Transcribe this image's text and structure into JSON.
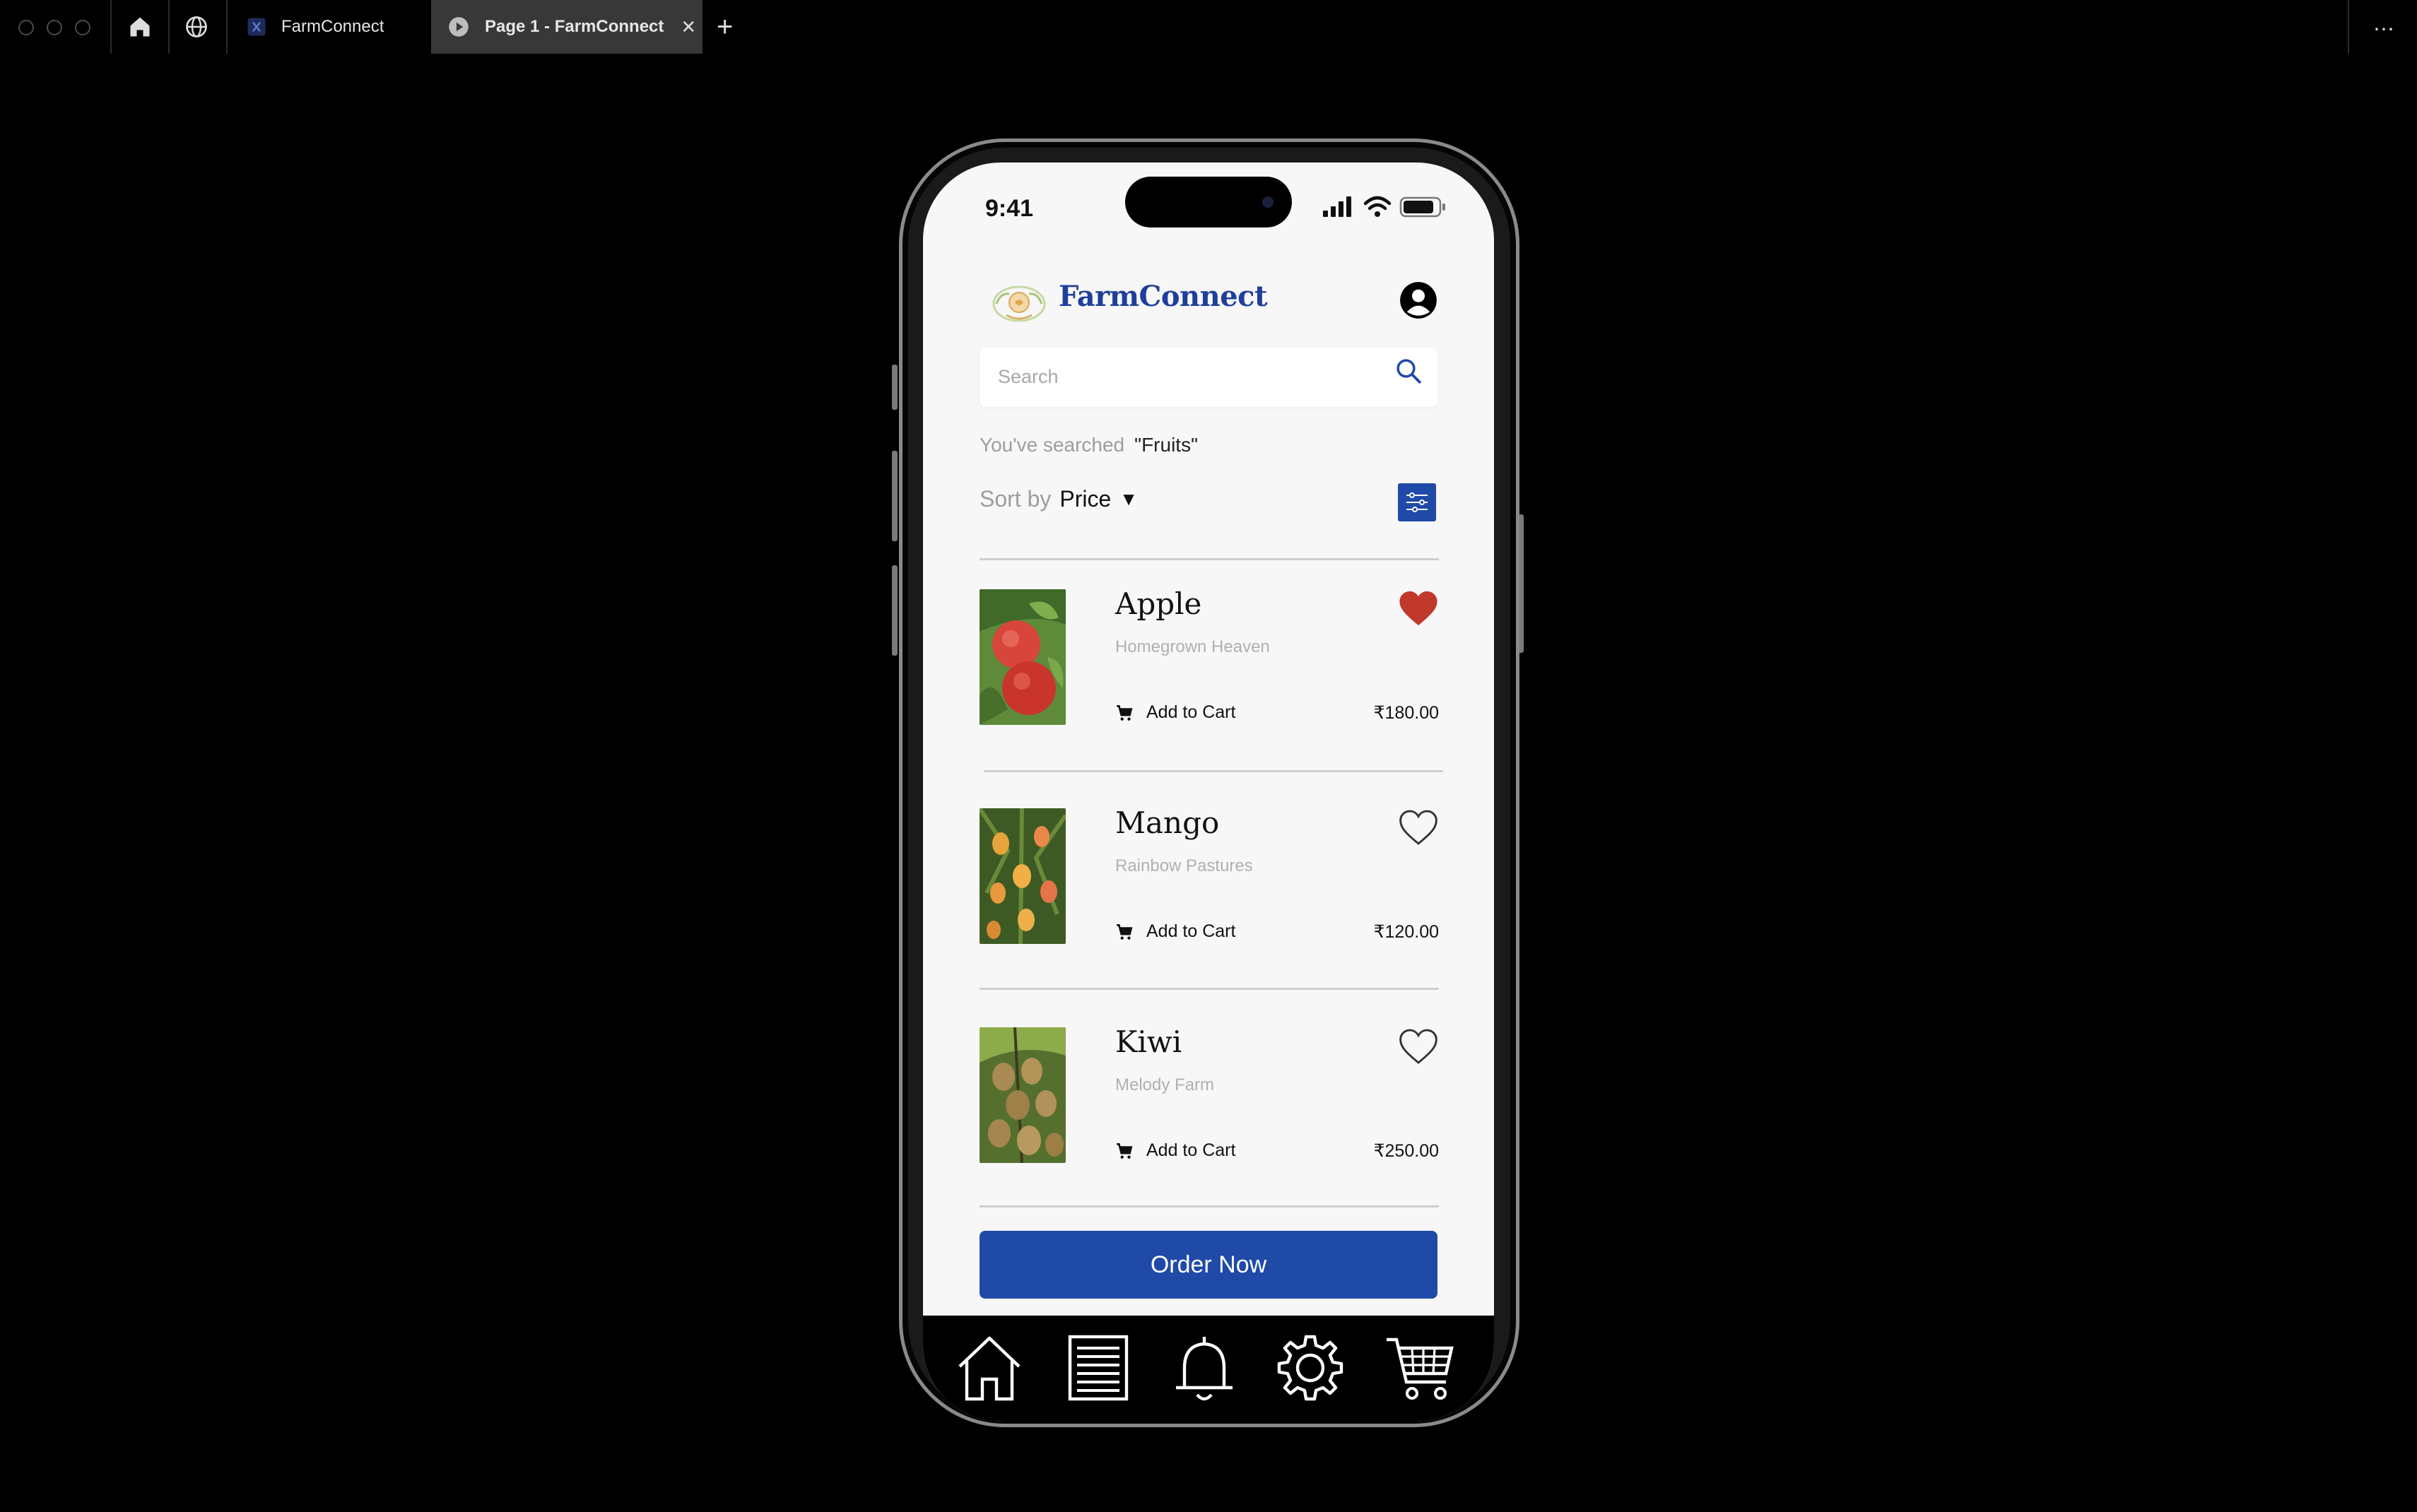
{
  "browser": {
    "tabs": [
      {
        "label": "FarmConnect",
        "icon": "figma-file-icon"
      },
      {
        "label": "Page 1 - FarmConnect",
        "icon": "play-icon",
        "close": "✕"
      }
    ],
    "new_tab": "+",
    "more": "⋯"
  },
  "status_bar": {
    "time": "9:41"
  },
  "app": {
    "brand": "FarmConnect",
    "search": {
      "placeholder": "Search",
      "value": ""
    },
    "searched_prefix": "You've searched",
    "searched_term": "\"Fruits\"",
    "sort_prefix": "Sort by",
    "sort_value": "Price",
    "sort_caret": "▼",
    "products": [
      {
        "name": "Apple",
        "farm": "Homegrown Heaven",
        "cart_label": "Add to Cart",
        "price": "₹180.00",
        "favorite": true
      },
      {
        "name": "Mango",
        "farm": "Rainbow Pastures",
        "cart_label": "Add to Cart",
        "price": "₹120.00",
        "favorite": false
      },
      {
        "name": "Kiwi",
        "farm": "Melody Farm",
        "cart_label": "Add to Cart",
        "price": "₹250.00",
        "favorite": false
      }
    ],
    "order_button": "Order Now",
    "nav": [
      "home-icon",
      "orders-list-icon",
      "bell-icon",
      "settings-gear-icon",
      "cart-icon"
    ]
  },
  "colors": {
    "accent": "#1f4aa8",
    "brand_text": "#1f3f9a",
    "heart": "#c0392b"
  }
}
